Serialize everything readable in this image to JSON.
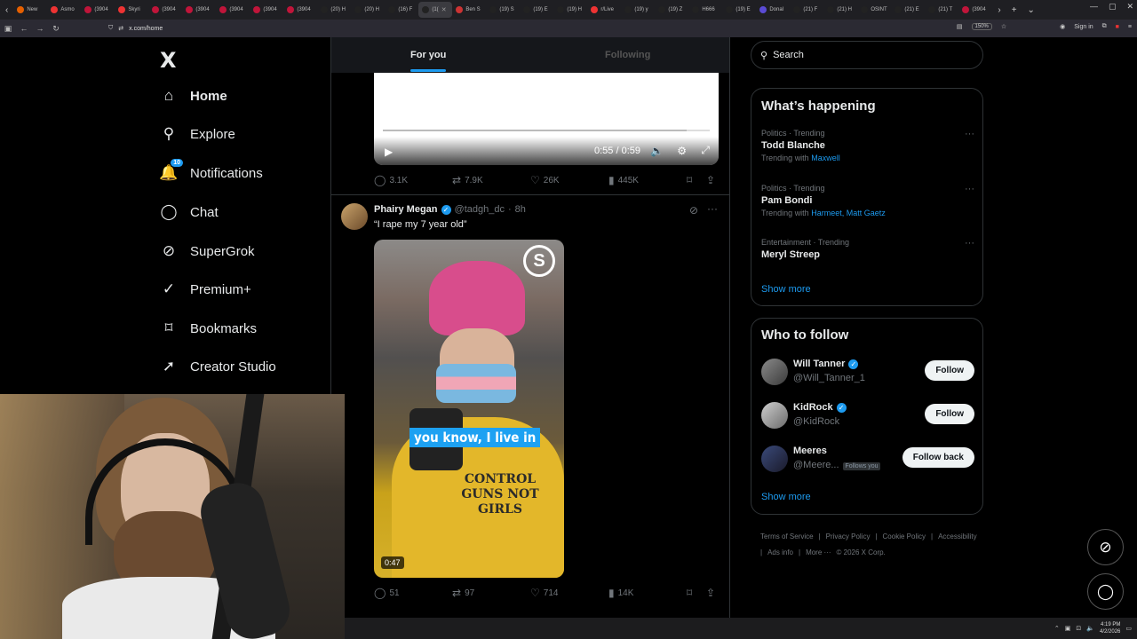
{
  "browser": {
    "tabs": [
      {
        "label": "New",
        "color": "#e66000"
      },
      {
        "label": "Asmo",
        "color": "#e33"
      },
      {
        "label": "(3904",
        "color": "#c0153a"
      },
      {
        "label": "Skyri",
        "color": "#e33"
      },
      {
        "label": "(3904",
        "color": "#c0153a"
      },
      {
        "label": "(3904",
        "color": "#c0153a"
      },
      {
        "label": "(3904",
        "color": "#c0153a"
      },
      {
        "label": "(3904",
        "color": "#c0153a"
      },
      {
        "label": "(3904",
        "color": "#c0153a"
      },
      {
        "label": "(20) H",
        "color": "#222"
      },
      {
        "label": "(20) H",
        "color": "#222"
      },
      {
        "label": "(16) F",
        "color": "#222"
      },
      {
        "label": "(1(",
        "color": "#222",
        "active": true
      },
      {
        "label": "Ben S",
        "color": "#c33"
      },
      {
        "label": "(19) S",
        "color": "#222"
      },
      {
        "label": "(19) E",
        "color": "#222"
      },
      {
        "label": "(19) H",
        "color": "#222"
      },
      {
        "label": "r/Live",
        "color": "#e33"
      },
      {
        "label": "(19) y",
        "color": "#222"
      },
      {
        "label": "(19) Z",
        "color": "#222"
      },
      {
        "label": "H666",
        "color": "#222"
      },
      {
        "label": "(19) E",
        "color": "#222"
      },
      {
        "label": "Donal",
        "color": "#5a4bd4"
      },
      {
        "label": "(21) F",
        "color": "#222"
      },
      {
        "label": "(21) H",
        "color": "#222"
      },
      {
        "label": "OSINT",
        "color": "#222"
      },
      {
        "label": "(21) E",
        "color": "#222"
      },
      {
        "label": "(21) T",
        "color": "#222"
      },
      {
        "label": "(3904",
        "color": "#c0153a"
      }
    ],
    "url": "x.com/home",
    "zoom": "150%",
    "sign_in": "Sign in"
  },
  "nav": {
    "logo": "X",
    "items": [
      {
        "label": "Home",
        "icon": "home-icon",
        "glyph": "⌂",
        "active": true
      },
      {
        "label": "Explore",
        "icon": "search-icon",
        "glyph": "⚲"
      },
      {
        "label": "Notifications",
        "icon": "bell-icon",
        "glyph": "🔔",
        "badge": "10"
      },
      {
        "label": "Chat",
        "icon": "chat-icon",
        "glyph": "◯"
      },
      {
        "label": "SuperGrok",
        "icon": "grok-icon",
        "glyph": "⊘"
      },
      {
        "label": "Premium+",
        "icon": "verified-icon",
        "glyph": "✓"
      },
      {
        "label": "Bookmarks",
        "icon": "bookmark-icon",
        "glyph": "⌑"
      },
      {
        "label": "Creator Studio",
        "icon": "rocket-icon",
        "glyph": "➚"
      }
    ]
  },
  "feed": {
    "tabs": {
      "for_you": "For you",
      "following": "Following"
    },
    "video1": {
      "time": "0:55 / 0:59",
      "progress": 0.93,
      "actions": {
        "replies": "3.1K",
        "reposts": "7.9K",
        "likes": "26K",
        "views": "445K"
      }
    },
    "tweet": {
      "name": "Phairy Megan",
      "handle": "@tadgh_dc",
      "time": "8h",
      "text": "“I rape my 7 year old”",
      "video": {
        "caption": "you know, I live in",
        "shirt_text": "CONTROL GUNS NOT GIRLS",
        "logo": "S",
        "duration": "0:47"
      },
      "actions": {
        "replies": "51",
        "reposts": "97",
        "likes": "714",
        "views": "14K"
      }
    }
  },
  "sidebar": {
    "search_placeholder": "Search",
    "happening": {
      "title": "What’s happening",
      "trends": [
        {
          "category": "Politics · Trending",
          "name": "Todd Blanche",
          "with_prefix": "Trending with",
          "with": "Maxwell"
        },
        {
          "category": "Politics · Trending",
          "name": "Pam Bondi",
          "with_prefix": "Trending with",
          "with": "Harmeet, Matt Gaetz"
        },
        {
          "category": "Entertainment · Trending",
          "name": "Meryl Streep",
          "with_prefix": "",
          "with": ""
        }
      ],
      "show_more": "Show more"
    },
    "who_to_follow": {
      "title": "Who to follow",
      "accounts": [
        {
          "name": "Will Tanner",
          "handle": "@Will_Tanner_1",
          "verified": true,
          "button": "Follow",
          "follows_you": ""
        },
        {
          "name": "KidRock",
          "handle": "@KidRock",
          "verified": true,
          "button": "Follow",
          "follows_you": ""
        },
        {
          "name": "Meeres",
          "handle": "@Meere...",
          "verified": false,
          "button": "Follow back",
          "follows_you": "Follows you"
        }
      ],
      "show_more": "Show more"
    },
    "footer": {
      "links": [
        "Terms of Service",
        "|",
        "Privacy Policy",
        "|",
        "Cookie Policy",
        "|",
        "Accessibility",
        "|",
        "Ads info",
        "|",
        "More ···",
        "© 2026 X Corp."
      ]
    }
  },
  "taskbar": {
    "time": "4:19 PM",
    "date": "4/2/2026"
  }
}
